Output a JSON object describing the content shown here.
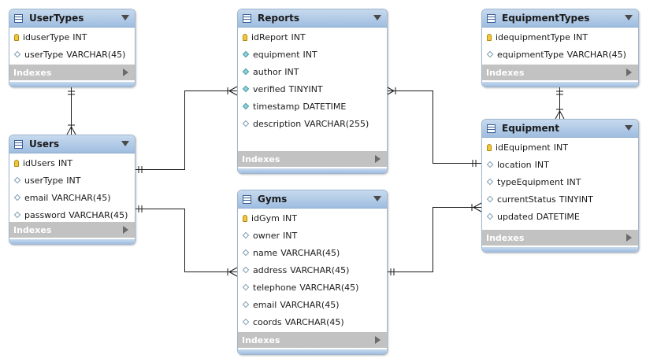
{
  "diagram": {
    "indexes_label": "Indexes",
    "tables": {
      "usertypes": {
        "name": "UserTypes",
        "columns": [
          {
            "name": "iduserType",
            "type": "INT",
            "kind": "pk"
          },
          {
            "name": "userType",
            "type": "VARCHAR(45)",
            "kind": "plain"
          }
        ]
      },
      "reports": {
        "name": "Reports",
        "columns": [
          {
            "name": "idReport",
            "type": "INT",
            "kind": "pk"
          },
          {
            "name": "equipment",
            "type": "INT",
            "kind": "fk"
          },
          {
            "name": "author",
            "type": "INT",
            "kind": "fk"
          },
          {
            "name": "verified",
            "type": "TINYINT",
            "kind": "fk"
          },
          {
            "name": "timestamp",
            "type": "DATETIME",
            "kind": "fk"
          },
          {
            "name": "description",
            "type": "VARCHAR(255)",
            "kind": "plain"
          }
        ]
      },
      "equipmenttypes": {
        "name": "EquipmentTypes",
        "columns": [
          {
            "name": "idequipmentType",
            "type": "INT",
            "kind": "pk"
          },
          {
            "name": "equipmentType",
            "type": "VARCHAR(45)",
            "kind": "plain"
          }
        ]
      },
      "users": {
        "name": "Users",
        "columns": [
          {
            "name": "idUsers",
            "type": "INT",
            "kind": "pk"
          },
          {
            "name": "userType",
            "type": "INT",
            "kind": "plain"
          },
          {
            "name": "email",
            "type": "VARCHAR(45)",
            "kind": "plain"
          },
          {
            "name": "password",
            "type": "VARCHAR(45)",
            "kind": "plain"
          }
        ]
      },
      "equipment": {
        "name": "Equipment",
        "columns": [
          {
            "name": "idEquipment",
            "type": "INT",
            "kind": "pk"
          },
          {
            "name": "location",
            "type": "INT",
            "kind": "plain"
          },
          {
            "name": "typeEquipment",
            "type": "INT",
            "kind": "plain"
          },
          {
            "name": "currentStatus",
            "type": "TINYINT",
            "kind": "plain"
          },
          {
            "name": "updated",
            "type": "DATETIME",
            "kind": "plain"
          }
        ]
      },
      "gyms": {
        "name": "Gyms",
        "columns": [
          {
            "name": "idGym",
            "type": "INT",
            "kind": "pk"
          },
          {
            "name": "owner",
            "type": "INT",
            "kind": "plain"
          },
          {
            "name": "name",
            "type": "VARCHAR(45)",
            "kind": "plain"
          },
          {
            "name": "address",
            "type": "VARCHAR(45)",
            "kind": "plain"
          },
          {
            "name": "telephone",
            "type": "VARCHAR(45)",
            "kind": "plain"
          },
          {
            "name": "email",
            "type": "VARCHAR(45)",
            "kind": "plain"
          },
          {
            "name": "coords",
            "type": "VARCHAR(45)",
            "kind": "plain"
          }
        ]
      }
    },
    "colors": {
      "header": "#9fbde0",
      "indexes_bar": "#c2c2c2",
      "connector": "#1a1a1a",
      "pk_key": "#f0c83c",
      "fk_diamond": "#8fd2d8"
    }
  }
}
